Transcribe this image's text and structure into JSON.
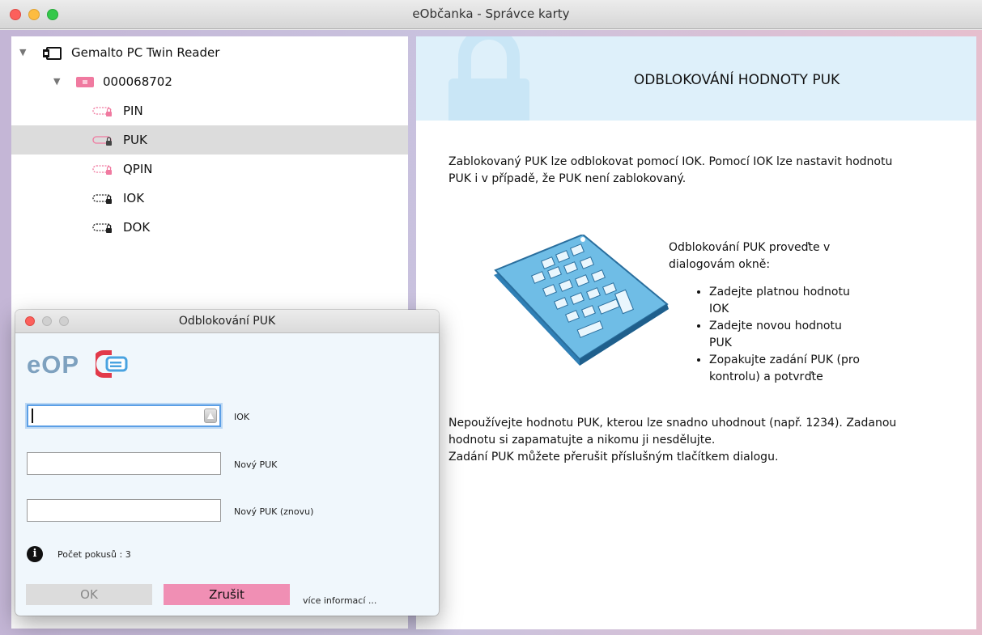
{
  "window": {
    "title": "eObčanka - Správce karty"
  },
  "tree": {
    "reader": "Gemalto PC Twin Reader",
    "card": "000068702",
    "items": [
      {
        "label": "PIN",
        "icon": "pin-key-icon",
        "selected": false
      },
      {
        "label": "PUK",
        "icon": "puk-key-icon",
        "selected": true
      },
      {
        "label": "QPIN",
        "icon": "qpin-key-icon",
        "selected": false
      },
      {
        "label": "IOK",
        "icon": "iok-key-icon",
        "selected": false
      },
      {
        "label": "DOK",
        "icon": "dok-key-icon",
        "selected": false
      }
    ]
  },
  "info": {
    "title": "ODBLOKOVÁNÍ HODNOTY PUK",
    "intro_line1": "Zablokovaný PUK lze odblokovat pomocí IOK. Pomocí IOK lze nastavit hodnotu",
    "intro_line2": "PUK i v případě, že PUK není zablokovaný.",
    "steps_intro_line1": "Odblokování PUK proveďte v",
    "steps_intro_line2": "dialogovám okně:",
    "steps": [
      "Zadejte platnou hodnotu IOK",
      "Zadejte novou hodnotu PUK",
      "Zopakujte zadání PUK (pro kontrolu) a potvrďte"
    ],
    "warning_line1": "Nepoužívejte hodnotu PUK, kterou lze snadno uhodnout (např. 1234). Zadanou",
    "warning_line2": "hodnotu si zapamatujte a nikomu ji nesdělujte.",
    "warning_line3": "Zadání PUK můžete přerušit příslušným tlačítkem dialogu."
  },
  "dialog": {
    "title": "Odblokování PUK",
    "logo_text": "eOP",
    "fields": {
      "iok": {
        "label": "IOK",
        "value": ""
      },
      "new_puk": {
        "label": "Nový PUK",
        "value": ""
      },
      "new_puk_again": {
        "label": "Nový PUK (znovu)",
        "value": ""
      }
    },
    "attempts": "Počet pokusů : 3",
    "ok_label": "OK",
    "cancel_label": "Zrušit",
    "more_info": "více informací ..."
  },
  "colors": {
    "accent_pink": "#f08fb4",
    "header_blue": "#def0fa",
    "selection_gray": "#dcdcdc",
    "logo_blue": "#7ea1bf",
    "logo_red": "#e23a4a"
  }
}
